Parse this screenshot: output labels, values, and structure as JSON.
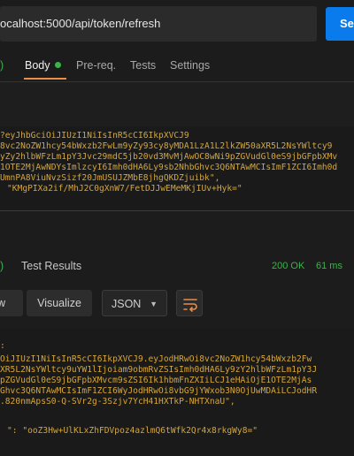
{
  "request": {
    "url": "ocalhost:5000/api/token/refresh",
    "send_label": "Se"
  },
  "request_tabs": {
    "partial_count": ")",
    "body": "Body",
    "prereq": "Pre-req.",
    "tests": "Tests",
    "settings": "Settings"
  },
  "request_body_lines": [
    "?eyJhbGciOiJIUzI1NiIsInR5cCI6IkpXVCJ9",
    "8vc2NoZW1hcy54bWxzb2FwLm9yZy93cy8yMDA1LzA1L2lkZW50aXR5L2NsYWltcy9",
    "yZy2hlbWFzLm1pY3Jvc29mdC5jb20vd3MvMjAwOC8wNi9pZGVudGl0eS9jbGFpbXMv",
    "1OTE2MjAwNDYsImlzcyI6Imh0dHA6Ly9sb2NhbGhvc3Q6NTAwMCIsImF1ZCI6Imh0d",
    "UmnPA8ViuNvzSizf20JmUSUJZMbE8jhgQKDZjuibk\",",
    "\"KMgPIXa2if/MhJ2C0gXnW7/FetDJJwEMeMKjIUv+Hyk=\""
  ],
  "response": {
    "partial_count": ")",
    "title": "Test Results",
    "status": "200 OK",
    "time": "61 ms"
  },
  "response_toolbar": {
    "pretty": "ew",
    "visualize": "Visualize",
    "format": "JSON"
  },
  "response_body_lines": [
    ":",
    "OiJIUzI1NiIsInR5cCI6IkpXVCJ9.eyJodHRwOi8vc2NoZW1hcy54bWxzb2Fw",
    "XR5L2NsYWltcy9uYW1lIjoiam9obmRvZSIsImh0dHA6Ly9zY2hlbWFzLm1pY3J",
    "pZGVudGl0eS9jbGFpbXMvcm9sZSI6Ik1hbmFnZXIiLCJ1eHAiOjE1OTE2MjAs",
    "Ghvc3Q6NTAwMCIsImF1ZCI6WyJodHRwOi8vbG9jYWxob3N0OjUwMDAiLCJodHR",
    ".820nmApsS0-Q-SVr2g-3Szjv7YcH41HXTkP-NHTXnaU\",",
    "\": \"ooZ3Hw+UlKLxZhFDVpoz4azlmQ6tWfk2Qr4x8rkgWy8=\""
  ],
  "colors": {
    "accent_orange": "#e98d49",
    "send_blue": "#097bed",
    "success_green": "#3bb34a",
    "string_yellow": "#d5a63a"
  }
}
